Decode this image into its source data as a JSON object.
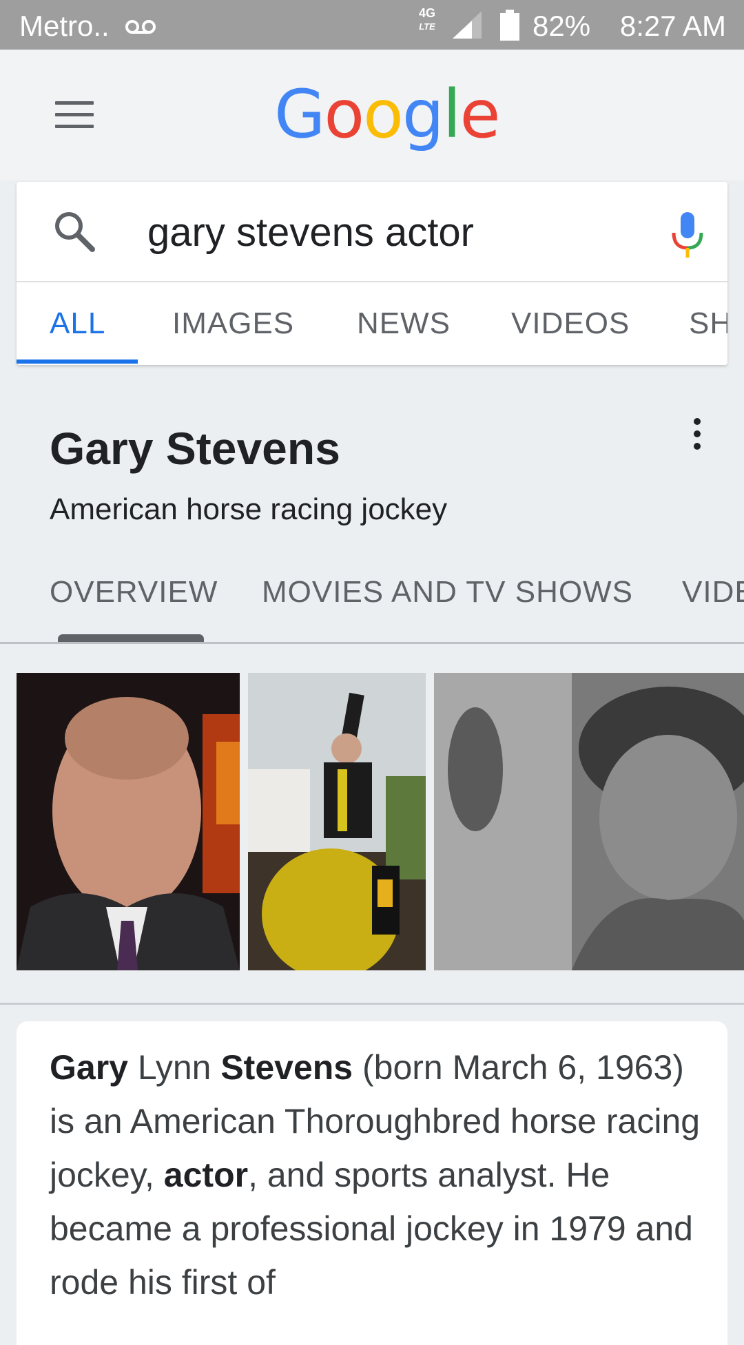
{
  "status_bar": {
    "carrier": "Metro..",
    "voicemail_icon": "oo",
    "network": "4G",
    "network_sub": "LTE",
    "battery": "82%",
    "time": "8:27 AM"
  },
  "header": {
    "logo": [
      "G",
      "o",
      "o",
      "g",
      "l",
      "e"
    ],
    "logo_colors": [
      "#4285F4",
      "#EA4335",
      "#FBBC05",
      "#4285F4",
      "#34A853",
      "#EA4335"
    ]
  },
  "search": {
    "query": "gary stevens actor",
    "tabs": [
      "ALL",
      "IMAGES",
      "NEWS",
      "VIDEOS",
      "SH"
    ]
  },
  "knowledge_panel": {
    "title": "Gary Stevens",
    "subtitle": "American horse racing jockey",
    "tabs": [
      "OVERVIEW",
      "MOVIES AND TV SHOWS",
      "VIDE"
    ]
  },
  "description": {
    "b1": "Gary",
    "t1": " Lynn ",
    "b2": "Stevens",
    "t2": " (born March 6, 1963) is an American Thoroughbred horse racing jockey, ",
    "b3": "actor",
    "t3": ", and sports analyst. He became a professional jockey in 1979 and rode his first of"
  },
  "colors": {
    "accent": "#1a73e8",
    "status_bar": "#9e9e9e",
    "background": "#eceff1"
  }
}
